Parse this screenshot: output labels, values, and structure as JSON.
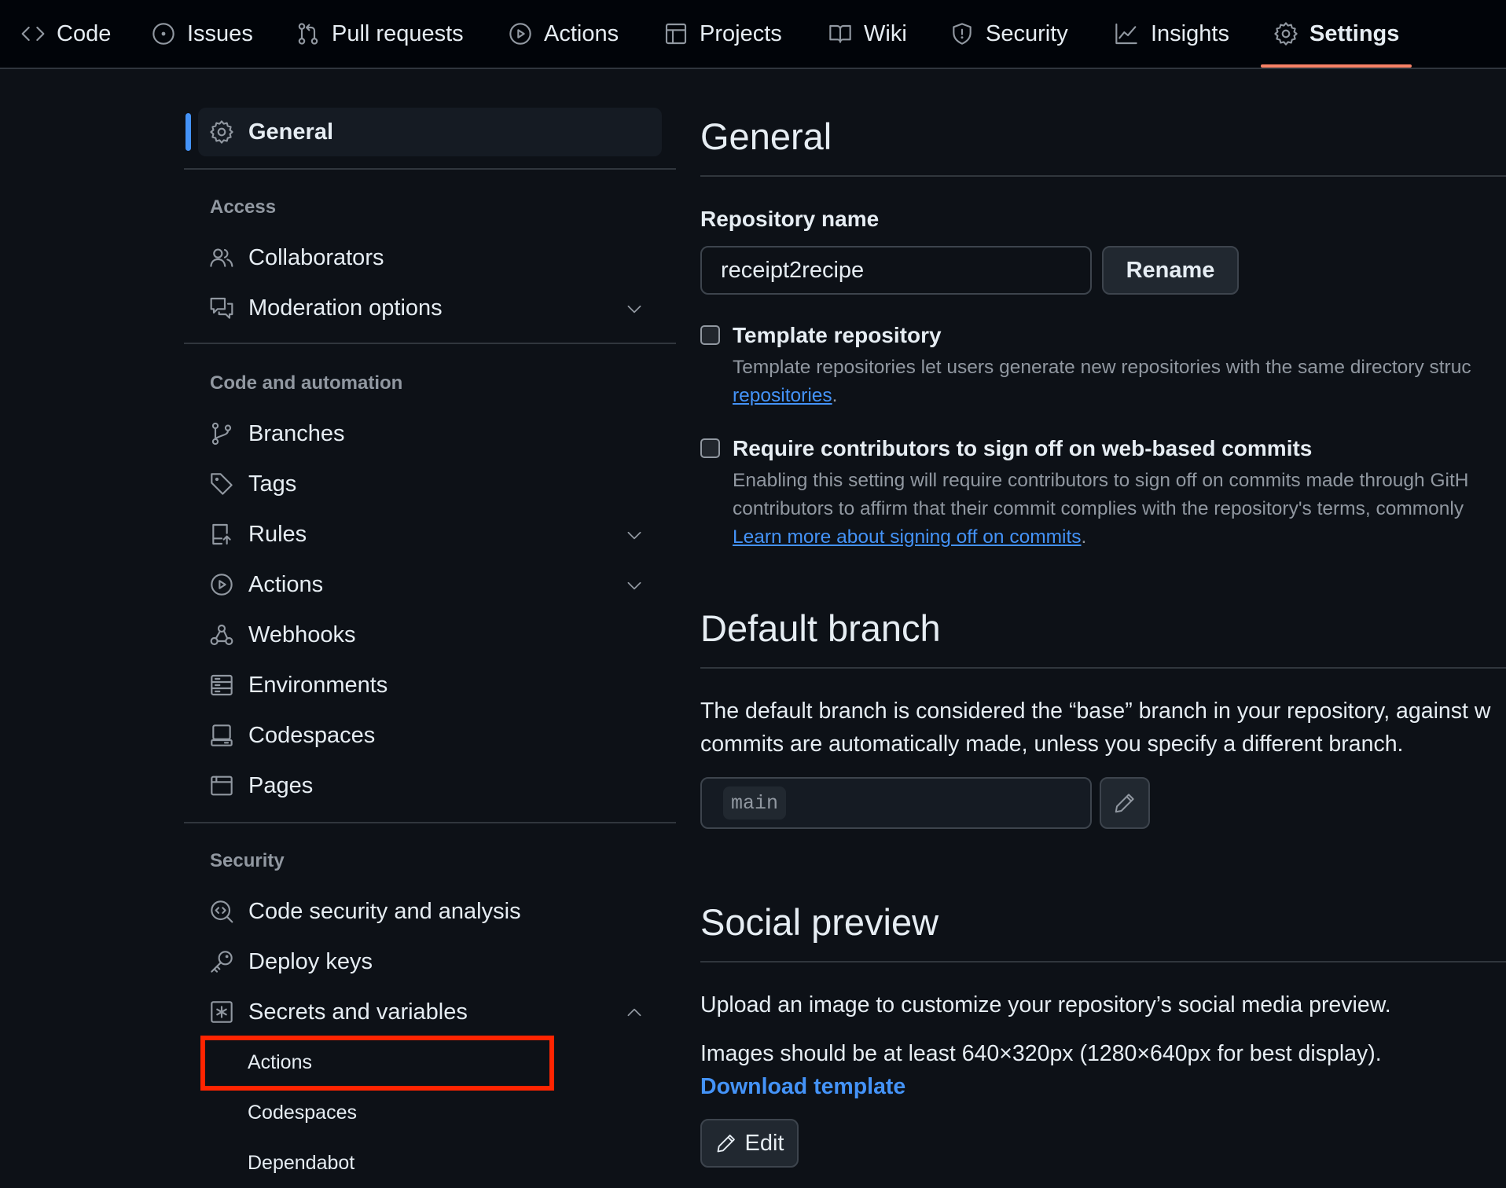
{
  "nav": {
    "tabs": [
      {
        "label": "Code",
        "icon": "code-icon"
      },
      {
        "label": "Issues",
        "icon": "issue-icon"
      },
      {
        "label": "Pull requests",
        "icon": "pull-request-icon"
      },
      {
        "label": "Actions",
        "icon": "play-icon"
      },
      {
        "label": "Projects",
        "icon": "table-icon"
      },
      {
        "label": "Wiki",
        "icon": "book-icon"
      },
      {
        "label": "Security",
        "icon": "shield-icon"
      },
      {
        "label": "Insights",
        "icon": "graph-icon"
      },
      {
        "label": "Settings",
        "icon": "gear-icon",
        "selected": true
      }
    ]
  },
  "sidebar": {
    "general": "General",
    "sections": [
      {
        "heading": "Access",
        "items": [
          "Collaborators",
          "Moderation options"
        ]
      },
      {
        "heading": "Code and automation",
        "items": [
          "Branches",
          "Tags",
          "Rules",
          "Actions",
          "Webhooks",
          "Environments",
          "Codespaces",
          "Pages"
        ]
      },
      {
        "heading": "Security",
        "items": [
          "Code security and analysis",
          "Deploy keys",
          "Secrets and variables"
        ]
      }
    ],
    "secrets_subitems": [
      "Actions",
      "Codespaces",
      "Dependabot"
    ],
    "highlighted_subitem": "Actions"
  },
  "main": {
    "title": "General",
    "repo_name_label": "Repository name",
    "repo_name_value": "receipt2recipe",
    "rename_button": "Rename",
    "template": {
      "label": "Template repository",
      "checked": false,
      "desc_line1": "Template repositories let users generate new repositories with the same directory struc",
      "desc_link": "repositories",
      "desc_end": "."
    },
    "signoff": {
      "label": "Require contributors to sign off on web-based commits",
      "checked": false,
      "desc_line1": "Enabling this setting will require contributors to sign off on commits made through GitH",
      "desc_line2": "contributors to affirm that their commit complies with the repository's terms, commonly",
      "desc_link": "Learn more about signing off on commits",
      "desc_end": "."
    },
    "default_branch": {
      "title": "Default branch",
      "text_line1": "The default branch is considered the “base” branch in your repository, against w",
      "text_line2": "commits are automatically made, unless you specify a different branch.",
      "branch": "main"
    },
    "social_preview": {
      "title": "Social preview",
      "text1": "Upload an image to customize your repository’s social media preview.",
      "text2": "Images should be at least 640×320px (1280×640px for best display).",
      "download_link": "Download template",
      "edit_button": "Edit"
    }
  },
  "colors": {
    "background": "#0d1117",
    "link": "#4493f8",
    "selected_tab_underline": "#f78166",
    "highlight_box": "#ff2400"
  }
}
